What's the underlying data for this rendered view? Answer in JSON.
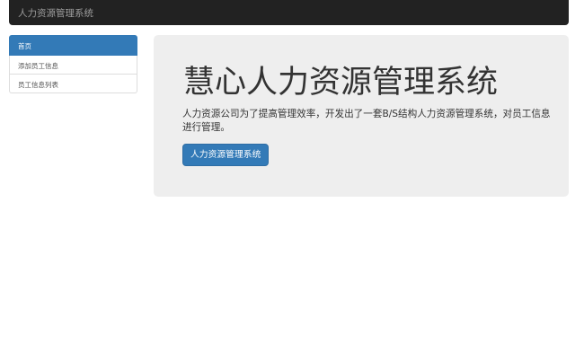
{
  "navbar": {
    "brand": "人力资源管理系统"
  },
  "sidebar": {
    "items": [
      {
        "label": "首页",
        "active": true
      },
      {
        "label": "添加员工信息",
        "active": false
      },
      {
        "label": "员工信息列表",
        "active": false
      }
    ]
  },
  "jumbotron": {
    "title": "慧心人力资源管理系统",
    "description": "人力资源公司为了提高管理效率，开发出了一套B/S结构人力资源管理系统，对员工信息进行管理。",
    "button_label": "人力资源管理系统"
  },
  "colors": {
    "navbar_bg": "#222222",
    "brand_text": "#9d9d9d",
    "primary": "#337ab7",
    "jumbotron_bg": "#eeeeee"
  }
}
